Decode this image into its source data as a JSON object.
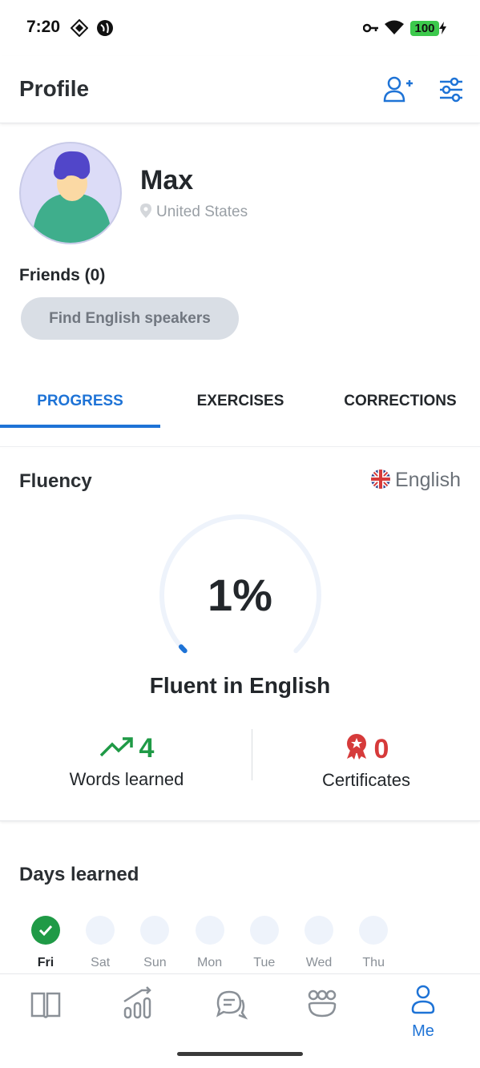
{
  "status_bar": {
    "time": "7:20",
    "battery": "100"
  },
  "header": {
    "title": "Profile",
    "icons": [
      "add-friend-icon",
      "filter-settings-icon"
    ]
  },
  "profile": {
    "name": "Max",
    "location": "United States"
  },
  "friends": {
    "label": "Friends (0)",
    "find_button": "Find English speakers"
  },
  "tabs": [
    {
      "label": "PROGRESS",
      "active": true
    },
    {
      "label": "EXERCISES",
      "active": false
    },
    {
      "label": "CORRECTIONS",
      "active": false
    }
  ],
  "fluency": {
    "title": "Fluency",
    "language": "English",
    "percent_text": "1%",
    "percent_value": 1,
    "label": "Fluent in English",
    "words_learned": {
      "value": "4",
      "label": "Words learned"
    },
    "certificates": {
      "value": "0",
      "label": "Certificates"
    }
  },
  "days": {
    "title": "Days learned",
    "items": [
      {
        "label": "Fri",
        "done": true
      },
      {
        "label": "Sat",
        "done": false
      },
      {
        "label": "Sun",
        "done": false
      },
      {
        "label": "Mon",
        "done": false
      },
      {
        "label": "Tue",
        "done": false
      },
      {
        "label": "Wed",
        "done": false
      },
      {
        "label": "Thu",
        "done": false
      }
    ]
  },
  "bottom_nav": {
    "items": [
      "book-icon",
      "stats-icon",
      "chat-icon",
      "community-icon",
      "me-icon"
    ],
    "me_label": "Me"
  },
  "colors": {
    "accent": "#1e73d6",
    "success": "#1f9a46",
    "danger": "#d63a3a",
    "battery": "#3cc94c"
  }
}
